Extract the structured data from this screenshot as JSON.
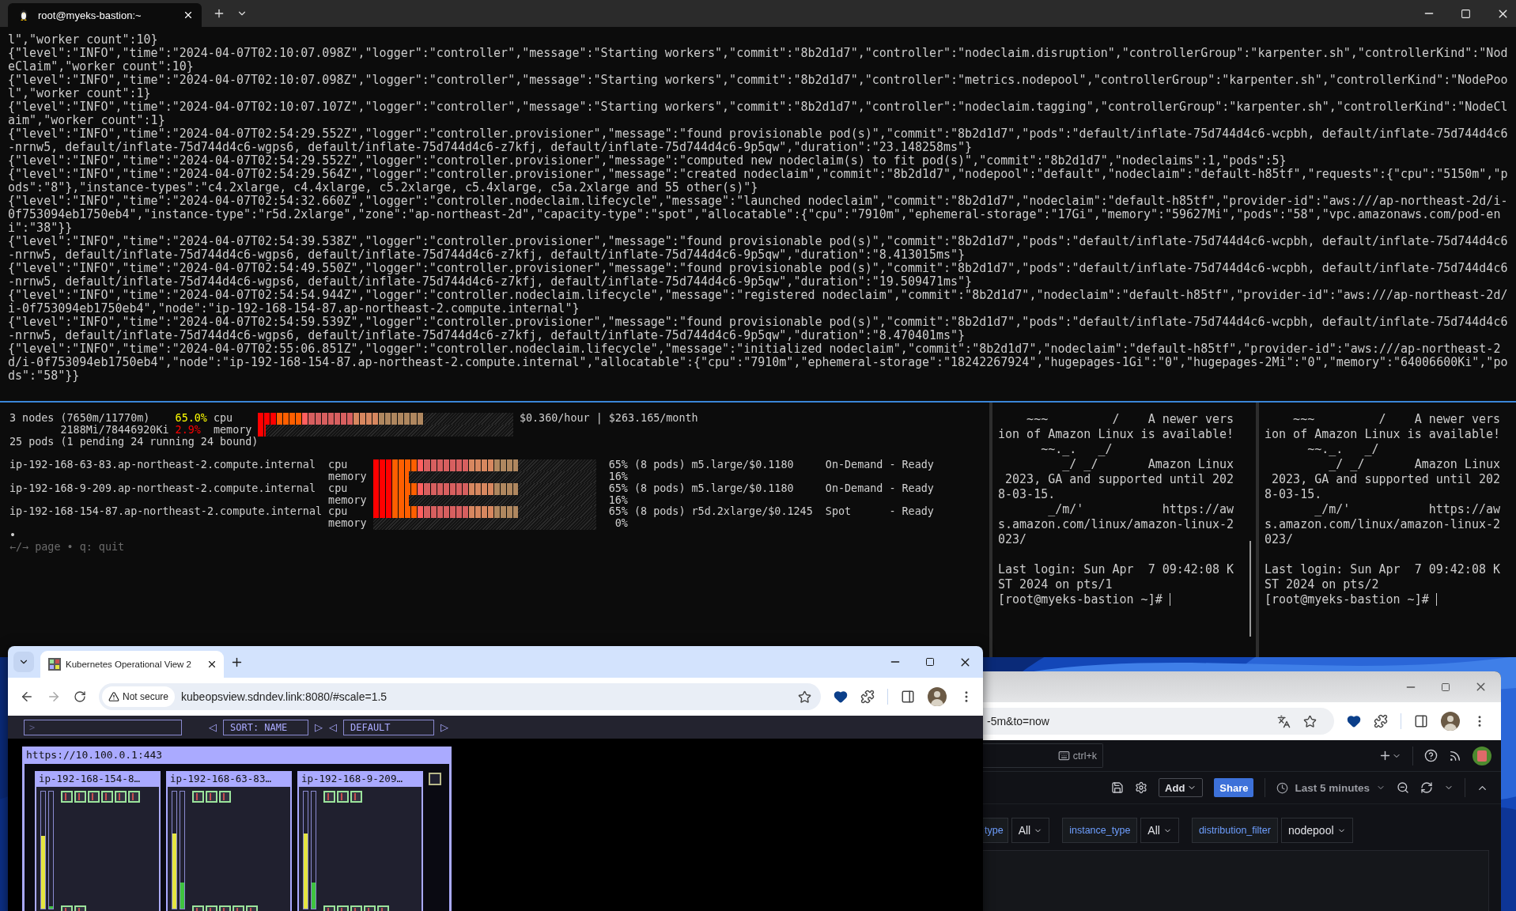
{
  "terminal": {
    "tabs": [
      {
        "title": "root@myeks-bastion:~",
        "selected": true
      }
    ],
    "log_records": [
      "l\",\"worker count\":10}",
      "{\"level\":\"INFO\",\"time\":\"2024-04-07T02:10:07.098Z\",\"logger\":\"controller\",\"message\":\"Starting workers\",\"commit\":\"8b2d1d7\",\"controller\":\"nodeclaim.disruption\",\"controllerGroup\":\"karpenter.sh\",\"controllerKind\":\"NodeClaim\",\"worker count\":10}",
      "{\"level\":\"INFO\",\"time\":\"2024-04-07T02:10:07.098Z\",\"logger\":\"controller\",\"message\":\"Starting workers\",\"commit\":\"8b2d1d7\",\"controller\":\"metrics.nodepool\",\"controllerGroup\":\"karpenter.sh\",\"controllerKind\":\"NodePool\",\"worker count\":1}",
      "{\"level\":\"INFO\",\"time\":\"2024-04-07T02:10:07.107Z\",\"logger\":\"controller\",\"message\":\"Starting workers\",\"commit\":\"8b2d1d7\",\"controller\":\"nodeclaim.tagging\",\"controllerGroup\":\"karpenter.sh\",\"controllerKind\":\"NodeClaim\",\"worker count\":1}",
      "{\"level\":\"INFO\",\"time\":\"2024-04-07T02:54:29.552Z\",\"logger\":\"controller.provisioner\",\"message\":\"found provisionable pod(s)\",\"commit\":\"8b2d1d7\",\"pods\":\"default/inflate-75d744d4c6-wcpbh, default/inflate-75d744d4c6-nrnw5, default/inflate-75d744d4c6-wgps6, default/inflate-75d744d4c6-z7kfj, default/inflate-75d744d4c6-9p5qw\",\"duration\":\"23.148258ms\"}",
      "{\"level\":\"INFO\",\"time\":\"2024-04-07T02:54:29.552Z\",\"logger\":\"controller.provisioner\",\"message\":\"computed new nodeclaim(s) to fit pod(s)\",\"commit\":\"8b2d1d7\",\"nodeclaims\":1,\"pods\":5}",
      "{\"level\":\"INFO\",\"time\":\"2024-04-07T02:54:29.564Z\",\"logger\":\"controller.provisioner\",\"message\":\"created nodeclaim\",\"commit\":\"8b2d1d7\",\"nodepool\":\"default\",\"nodeclaim\":\"default-h85tf\",\"requests\":{\"cpu\":\"5150m\",\"pods\":\"8\"},\"instance-types\":\"c4.2xlarge, c4.4xlarge, c5.2xlarge, c5.4xlarge, c5a.2xlarge and 55 other(s)\"}",
      "{\"level\":\"INFO\",\"time\":\"2024-04-07T02:54:32.660Z\",\"logger\":\"controller.nodeclaim.lifecycle\",\"message\":\"launched nodeclaim\",\"commit\":\"8b2d1d7\",\"nodeclaim\":\"default-h85tf\",\"provider-id\":\"aws:///ap-northeast-2d/i-0f753094eb1750eb4\",\"instance-type\":\"r5d.2xlarge\",\"zone\":\"ap-northeast-2d\",\"capacity-type\":\"spot\",\"allocatable\":{\"cpu\":\"7910m\",\"ephemeral-storage\":\"17Gi\",\"memory\":\"59627Mi\",\"pods\":\"58\",\"vpc.amazonaws.com/pod-eni\":\"38\"}}",
      "{\"level\":\"INFO\",\"time\":\"2024-04-07T02:54:39.538Z\",\"logger\":\"controller.provisioner\",\"message\":\"found provisionable pod(s)\",\"commit\":\"8b2d1d7\",\"pods\":\"default/inflate-75d744d4c6-wcpbh, default/inflate-75d744d4c6-nrnw5, default/inflate-75d744d4c6-wgps6, default/inflate-75d744d4c6-z7kfj, default/inflate-75d744d4c6-9p5qw\",\"duration\":\"8.413015ms\"}",
      "{\"level\":\"INFO\",\"time\":\"2024-04-07T02:54:49.550Z\",\"logger\":\"controller.provisioner\",\"message\":\"found provisionable pod(s)\",\"commit\":\"8b2d1d7\",\"pods\":\"default/inflate-75d744d4c6-wcpbh, default/inflate-75d744d4c6-nrnw5, default/inflate-75d744d4c6-wgps6, default/inflate-75d744d4c6-z7kfj, default/inflate-75d744d4c6-9p5qw\",\"duration\":\"19.509471ms\"}",
      "{\"level\":\"INFO\",\"time\":\"2024-04-07T02:54:54.944Z\",\"logger\":\"controller.nodeclaim.lifecycle\",\"message\":\"registered nodeclaim\",\"commit\":\"8b2d1d7\",\"nodeclaim\":\"default-h85tf\",\"provider-id\":\"aws:///ap-northeast-2d/i-0f753094eb1750eb4\",\"node\":\"ip-192-168-154-87.ap-northeast-2.compute.internal\"}",
      "{\"level\":\"INFO\",\"time\":\"2024-04-07T02:54:59.539Z\",\"logger\":\"controller.provisioner\",\"message\":\"found provisionable pod(s)\",\"commit\":\"8b2d1d7\",\"pods\":\"default/inflate-75d744d4c6-wcpbh, default/inflate-75d744d4c6-nrnw5, default/inflate-75d744d4c6-wgps6, default/inflate-75d744d4c6-z7kfj, default/inflate-75d744d4c6-9p5qw\",\"duration\":\"8.470401ms\"}",
      "{\"level\":\"INFO\",\"time\":\"2024-04-07T02:55:06.851Z\",\"logger\":\"controller.nodeclaim.lifecycle\",\"message\":\"initialized nodeclaim\",\"commit\":\"8b2d1d7\",\"nodeclaim\":\"default-h85tf\",\"provider-id\":\"aws:///ap-northeast-2d/i-0f753094eb1750eb4\",\"node\":\"ip-192-168-154-87.ap-northeast-2.compute.internal\",\"allocatable\":{\"cpu\":\"7910m\",\"ephemeral-storage\":\"18242267924\",\"hugepages-1Gi\":\"0\",\"hugepages-2Mi\":\"0\",\"memory\":\"64006600Ki\",\"pods\":\"58\"}}"
    ],
    "node_viewer": {
      "summary": [
        {
          "label": "3 nodes (7650m/11770m)",
          "percent": "65.0%",
          "color": "#ffff00",
          "metric": "cpu",
          "level": 0.65,
          "cost": "$0.360/hour | $263.165/month"
        },
        {
          "label": "2188Mi/78446920Ki",
          "percent": "2.9%",
          "color": "#ff0000",
          "metric": "memory",
          "level": 0.029
        }
      ],
      "pods_line": "25 pods (1 pending 24 running 24 bound)",
      "nodes": [
        {
          "name": "ip-192-168-63-83.ap-northeast-2.compute.internal",
          "metrics": [
            {
              "metric": "cpu",
              "level": 0.65,
              "percent": "65%"
            },
            {
              "metric": "memory",
              "level": 0.16,
              "percent": "16%"
            }
          ],
          "pods": "(8 pods)",
          "instance": "m5.large/$0.1180",
          "capacity": "On-Demand",
          "status": "- Ready"
        },
        {
          "name": "ip-192-168-9-209.ap-northeast-2.compute.internal",
          "metrics": [
            {
              "metric": "cpu",
              "level": 0.65,
              "percent": "65%"
            },
            {
              "metric": "memory",
              "level": 0.16,
              "percent": "16%"
            }
          ],
          "pods": "(8 pods)",
          "instance": "m5.large/$0.1180",
          "capacity": "On-Demand",
          "status": "- Ready"
        },
        {
          "name": "ip-192-168-154-87.ap-northeast-2.compute.internal",
          "metrics": [
            {
              "metric": "cpu",
              "level": 0.65,
              "percent": "65%"
            },
            {
              "metric": "memory",
              "level": 0,
              "percent": "0%"
            }
          ],
          "pods": "(8 pods)",
          "instance": "r5d.2xlarge/$0.1245",
          "capacity": "Spot",
          "status": "- Ready"
        }
      ],
      "bullet": "•",
      "help": "←/→ page • q: quit"
    },
    "panes": [
      {
        "paragraphs": [
          [
            "    ~~~         /    A newer vers",
            "ion of Amazon Linux is available!",
            "      ~~._.   _/",
            "         _/ _/       Amazon Linux",
            " 2023, GA and supported until 202",
            "8-03-15.",
            "       _/m/'           https://aw",
            "s.amazon.com/linux/amazon-linux-2",
            "023/"
          ],
          [
            "Last login: Sun Apr  7 09:42:08 K",
            "ST 2024 on pts/1"
          ]
        ],
        "prompt": "[root@myeks-bastion ~]# "
      },
      {
        "paragraphs": [
          [
            "    ~~~         /    A newer vers",
            "ion of Amazon Linux is available!",
            "      ~~._.   _/",
            "         _/ _/       Amazon Linux",
            " 2023, GA and supported until 202",
            "8-03-15.",
            "       _/m/'           https://aw",
            "s.amazon.com/linux/amazon-linux-2",
            "023/"
          ],
          [
            "Last login: Sun Apr  7 09:42:08 K",
            "ST 2024 on pts/2"
          ]
        ],
        "prompt": "[root@myeks-bastion ~]# "
      }
    ]
  },
  "kubeops_browser": {
    "tabs": [
      {
        "title": "Kubernetes Operational View 2",
        "selected": true
      }
    ],
    "security": "Not secure",
    "url": "kubeopsview.sdndev.link:8080/#scale=1.5",
    "filter_placeholder": ">",
    "prev_arrow": "◁",
    "next_arrow": "▷",
    "sort": "SORT: NAME",
    "theme_prev_arrow": "◁",
    "theme": "DEFAULT",
    "theme_next_arrow": "▷",
    "cluster": {
      "url": "https://10.100.0.1:443",
      "nodes": [
        {
          "name": "ip-192-168-154-8…",
          "meters": [
            {
              "kind": "cpu",
              "level": 0.62
            },
            {
              "kind": "memory",
              "level": 0.02
            }
          ],
          "top_pods": [
            {
              "kind": "pod"
            },
            {
              "kind": "pod"
            },
            {
              "kind": "pod"
            },
            {
              "kind": "pod"
            },
            {
              "kind": "pod"
            },
            {
              "kind": "pod"
            }
          ],
          "bottom_pods": [
            {
              "kind": "pod"
            },
            {
              "kind": "pod"
            }
          ]
        },
        {
          "name": "ip-192-168-63-83…",
          "meters": [
            {
              "kind": "cpu",
              "level": 0.64
            },
            {
              "kind": "memory",
              "level": 0.22
            }
          ],
          "top_pods": [
            {
              "kind": "pod"
            },
            {
              "kind": "pod"
            },
            {
              "kind": "pod"
            }
          ],
          "bottom_pods": [
            {
              "kind": "pod"
            },
            {
              "kind": "pod"
            },
            {
              "kind": "pod"
            },
            {
              "kind": "pod"
            },
            {
              "kind": "pod"
            }
          ]
        },
        {
          "name": "ip-192-168-9-209…",
          "meters": [
            {
              "kind": "cpu",
              "level": 0.64
            },
            {
              "kind": "memory",
              "level": 0.22
            }
          ],
          "top_pods": [
            {
              "kind": "pod"
            },
            {
              "kind": "pod"
            },
            {
              "kind": "pod"
            }
          ],
          "bottom_pods": [
            {
              "kind": "pod"
            },
            {
              "kind": "pod"
            },
            {
              "kind": "pod"
            },
            {
              "kind": "pod"
            },
            {
              "kind": "pod"
            }
          ]
        }
      ]
    }
  },
  "grafana_browser": {
    "url": "-5m&to=now",
    "search_shortcut": "ctrl+k",
    "add_button": "Add",
    "share_button": "Share",
    "time_range": "Last 5 minutes",
    "variables": [
      {
        "label": "type",
        "value": "All"
      },
      {
        "label": "instance_type",
        "value": "All"
      },
      {
        "label": "distribution_filter",
        "value": "nodepool"
      }
    ]
  }
}
